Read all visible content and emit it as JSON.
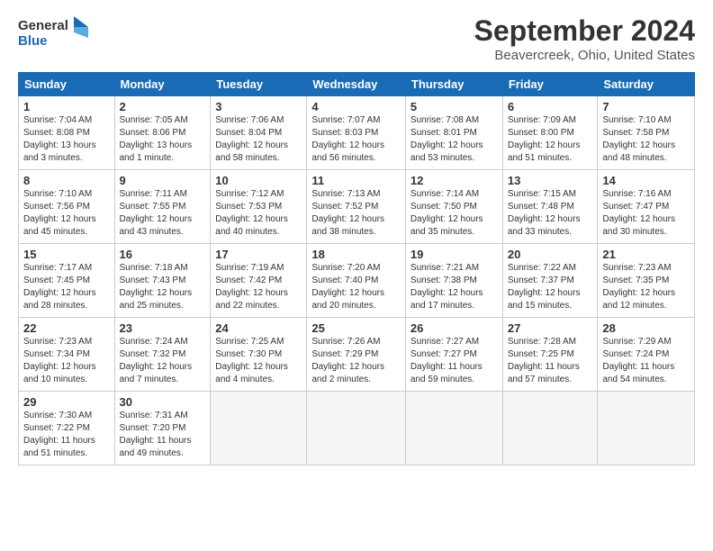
{
  "logo": {
    "line1": "General",
    "line2": "Blue"
  },
  "title": "September 2024",
  "subtitle": "Beavercreek, Ohio, United States",
  "headers": [
    "Sunday",
    "Monday",
    "Tuesday",
    "Wednesday",
    "Thursday",
    "Friday",
    "Saturday"
  ],
  "weeks": [
    [
      {
        "day": "1",
        "sunrise": "7:04 AM",
        "sunset": "8:08 PM",
        "daylight": "13 hours and 3 minutes."
      },
      {
        "day": "2",
        "sunrise": "7:05 AM",
        "sunset": "8:06 PM",
        "daylight": "13 hours and 1 minute."
      },
      {
        "day": "3",
        "sunrise": "7:06 AM",
        "sunset": "8:04 PM",
        "daylight": "12 hours and 58 minutes."
      },
      {
        "day": "4",
        "sunrise": "7:07 AM",
        "sunset": "8:03 PM",
        "daylight": "12 hours and 56 minutes."
      },
      {
        "day": "5",
        "sunrise": "7:08 AM",
        "sunset": "8:01 PM",
        "daylight": "12 hours and 53 minutes."
      },
      {
        "day": "6",
        "sunrise": "7:09 AM",
        "sunset": "8:00 PM",
        "daylight": "12 hours and 51 minutes."
      },
      {
        "day": "7",
        "sunrise": "7:10 AM",
        "sunset": "7:58 PM",
        "daylight": "12 hours and 48 minutes."
      }
    ],
    [
      {
        "day": "8",
        "sunrise": "7:10 AM",
        "sunset": "7:56 PM",
        "daylight": "12 hours and 45 minutes."
      },
      {
        "day": "9",
        "sunrise": "7:11 AM",
        "sunset": "7:55 PM",
        "daylight": "12 hours and 43 minutes."
      },
      {
        "day": "10",
        "sunrise": "7:12 AM",
        "sunset": "7:53 PM",
        "daylight": "12 hours and 40 minutes."
      },
      {
        "day": "11",
        "sunrise": "7:13 AM",
        "sunset": "7:52 PM",
        "daylight": "12 hours and 38 minutes."
      },
      {
        "day": "12",
        "sunrise": "7:14 AM",
        "sunset": "7:50 PM",
        "daylight": "12 hours and 35 minutes."
      },
      {
        "day": "13",
        "sunrise": "7:15 AM",
        "sunset": "7:48 PM",
        "daylight": "12 hours and 33 minutes."
      },
      {
        "day": "14",
        "sunrise": "7:16 AM",
        "sunset": "7:47 PM",
        "daylight": "12 hours and 30 minutes."
      }
    ],
    [
      {
        "day": "15",
        "sunrise": "7:17 AM",
        "sunset": "7:45 PM",
        "daylight": "12 hours and 28 minutes."
      },
      {
        "day": "16",
        "sunrise": "7:18 AM",
        "sunset": "7:43 PM",
        "daylight": "12 hours and 25 minutes."
      },
      {
        "day": "17",
        "sunrise": "7:19 AM",
        "sunset": "7:42 PM",
        "daylight": "12 hours and 22 minutes."
      },
      {
        "day": "18",
        "sunrise": "7:20 AM",
        "sunset": "7:40 PM",
        "daylight": "12 hours and 20 minutes."
      },
      {
        "day": "19",
        "sunrise": "7:21 AM",
        "sunset": "7:38 PM",
        "daylight": "12 hours and 17 minutes."
      },
      {
        "day": "20",
        "sunrise": "7:22 AM",
        "sunset": "7:37 PM",
        "daylight": "12 hours and 15 minutes."
      },
      {
        "day": "21",
        "sunrise": "7:23 AM",
        "sunset": "7:35 PM",
        "daylight": "12 hours and 12 minutes."
      }
    ],
    [
      {
        "day": "22",
        "sunrise": "7:23 AM",
        "sunset": "7:34 PM",
        "daylight": "12 hours and 10 minutes."
      },
      {
        "day": "23",
        "sunrise": "7:24 AM",
        "sunset": "7:32 PM",
        "daylight": "12 hours and 7 minutes."
      },
      {
        "day": "24",
        "sunrise": "7:25 AM",
        "sunset": "7:30 PM",
        "daylight": "12 hours and 4 minutes."
      },
      {
        "day": "25",
        "sunrise": "7:26 AM",
        "sunset": "7:29 PM",
        "daylight": "12 hours and 2 minutes."
      },
      {
        "day": "26",
        "sunrise": "7:27 AM",
        "sunset": "7:27 PM",
        "daylight": "11 hours and 59 minutes."
      },
      {
        "day": "27",
        "sunrise": "7:28 AM",
        "sunset": "7:25 PM",
        "daylight": "11 hours and 57 minutes."
      },
      {
        "day": "28",
        "sunrise": "7:29 AM",
        "sunset": "7:24 PM",
        "daylight": "11 hours and 54 minutes."
      }
    ],
    [
      {
        "day": "29",
        "sunrise": "7:30 AM",
        "sunset": "7:22 PM",
        "daylight": "11 hours and 51 minutes."
      },
      {
        "day": "30",
        "sunrise": "7:31 AM",
        "sunset": "7:20 PM",
        "daylight": "11 hours and 49 minutes."
      },
      null,
      null,
      null,
      null,
      null
    ]
  ]
}
